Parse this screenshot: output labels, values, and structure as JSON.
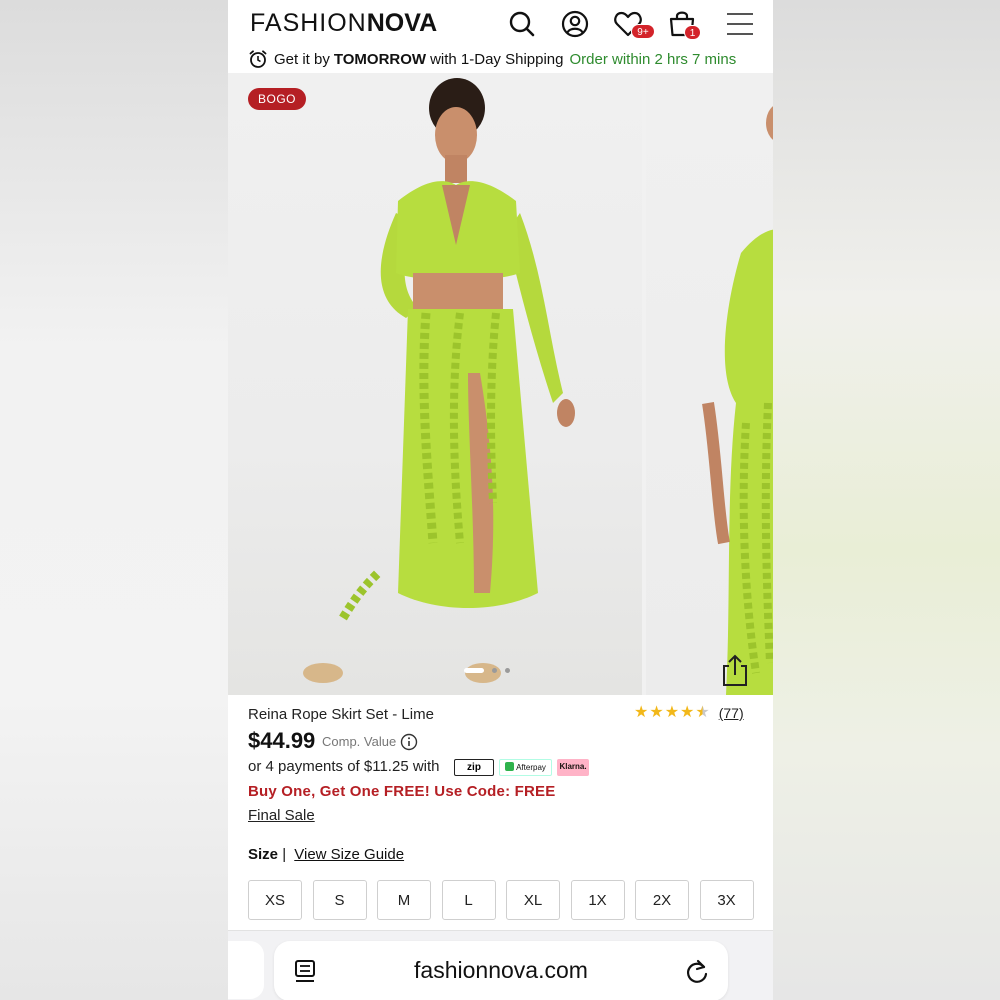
{
  "header": {
    "logo_light": "FASHION",
    "logo_bold": "NOVA",
    "wishlist_badge": "9+",
    "cart_badge": "1"
  },
  "shipping": {
    "prefix": "Get it by",
    "highlight": "TOMORROW",
    "suffix": "with 1-Day Shipping",
    "countdown": "Order within 2 hrs 7 mins"
  },
  "gallery": {
    "badge": "BOGO",
    "slide_count": 3,
    "active_slide": 1,
    "garment_color": "#b7dd3f"
  },
  "product": {
    "name": "Reina Rope Skirt Set - Lime",
    "rating": 4.5,
    "review_count": "(77)",
    "price": "$44.99",
    "comp_value": "Comp. Value",
    "installments": "or 4 payments of $11.25 with",
    "pay_logos": {
      "zip": "zip",
      "afterpay": "Afterpay",
      "klarna": "Klarna."
    },
    "promo": "Buy One, Get One FREE! Use Code: FREE",
    "final_sale": "Final Sale"
  },
  "size": {
    "label": "Size",
    "separator": "|",
    "guide": "View Size Guide",
    "options": [
      "XS",
      "S",
      "M",
      "L",
      "XL",
      "1X",
      "2X",
      "3X"
    ]
  },
  "browser": {
    "url": "fashionnova.com"
  },
  "colors": {
    "brand_red": "#b51f24",
    "green_text": "#2e8b2e",
    "star": "#f2b81a"
  }
}
